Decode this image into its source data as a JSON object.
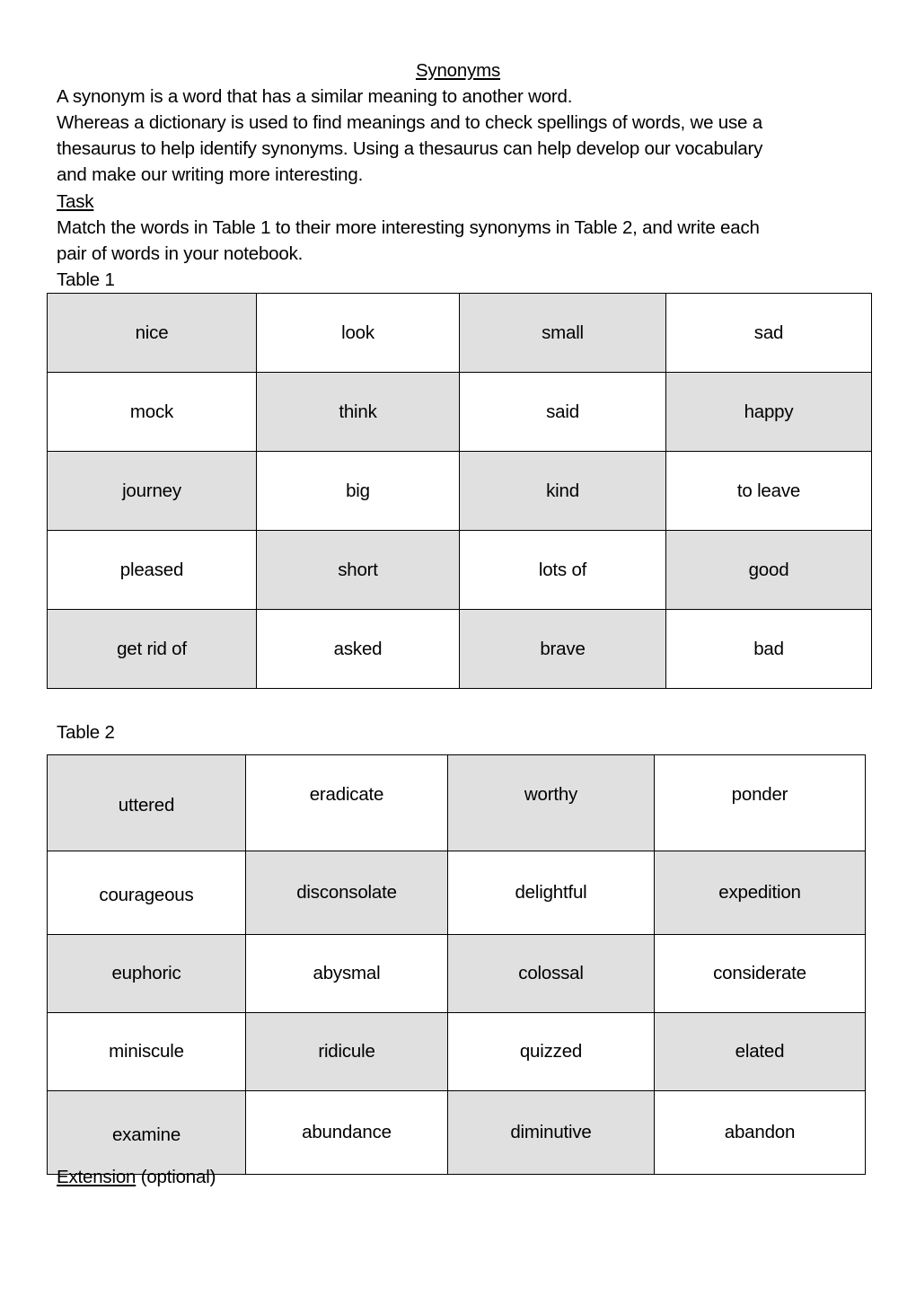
{
  "title": "Synonyms",
  "intro_line": "A synonym is a word that has a similar meaning to another word.",
  "paragraph_lines": [
    "Whereas a dictionary is used to find meanings and to check spellings of words, we use a",
    "thesaurus to help identify synonyms.  Using a thesaurus can help develop our vocabulary",
    "and make our writing more interesting."
  ],
  "task_heading": "Task",
  "task_lines": [
    "Match the words in Table 1 to their more interesting synonyms in Table 2, and write each",
    "pair of words in your notebook."
  ],
  "table1": {
    "label": "Table 1",
    "rows": [
      [
        "nice",
        "look",
        "small",
        "sad"
      ],
      [
        "mock",
        "think",
        "said",
        "happy"
      ],
      [
        "journey",
        "big",
        "kind",
        "to leave"
      ],
      [
        "pleased",
        "short",
        "lots of",
        "good"
      ],
      [
        "get rid of",
        "asked",
        "brave",
        "bad"
      ]
    ]
  },
  "table2": {
    "label": "Table 2",
    "rows": [
      [
        "uttered",
        "eradicate",
        "worthy",
        "ponder"
      ],
      [
        "courageous",
        "disconsolate",
        "delightful",
        "expedition"
      ],
      [
        "euphoric",
        "abysmal",
        "colossal",
        "considerate"
      ],
      [
        "miniscule",
        "ridicule",
        "quizzed",
        "elated"
      ],
      [
        "examine",
        "abundance",
        "diminutive",
        "abandon"
      ]
    ]
  },
  "extension": {
    "heading": "Extension",
    "note": " (optional)"
  },
  "colors": {
    "shaded_cell": "#e0e0e0",
    "plain_cell": "#ffffff",
    "border": "#000000"
  }
}
